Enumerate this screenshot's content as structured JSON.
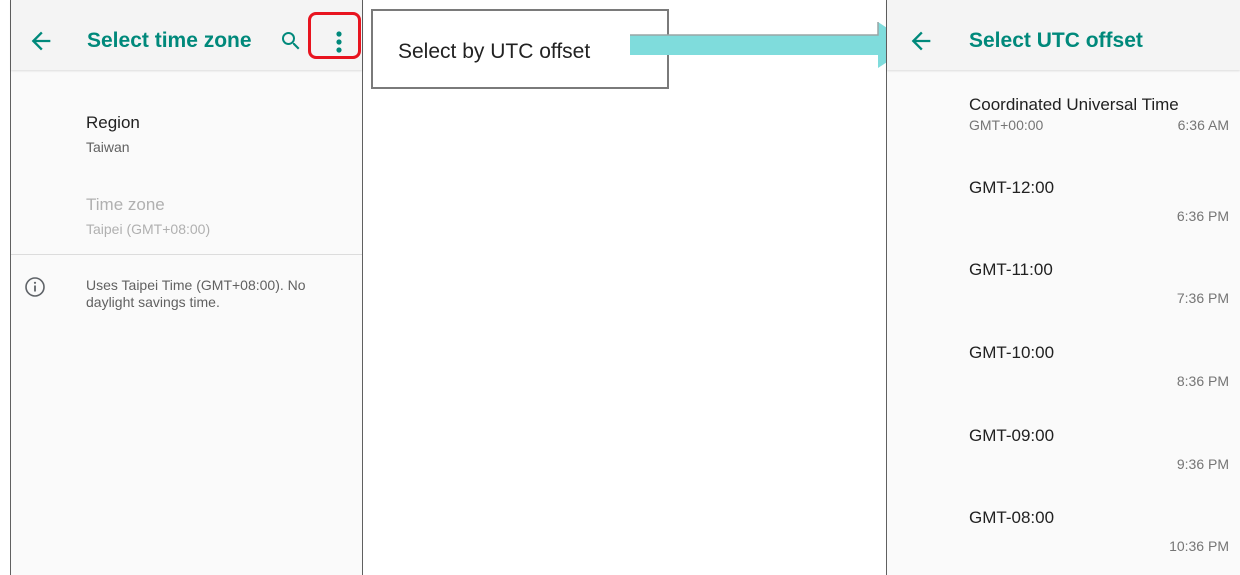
{
  "left_screen": {
    "title": "Select time zone",
    "icons": {
      "back": "arrow-left-icon",
      "search": "search-icon",
      "more": "more-vert-icon",
      "info": "info-icon"
    },
    "region": {
      "title": "Region",
      "value": "Taiwan"
    },
    "time_zone": {
      "title": "Time zone",
      "value": "Taipei (GMT+08:00)"
    },
    "footer": "Uses Taipei Time (GMT+08:00). No daylight savings time."
  },
  "callout": {
    "text": "Select by UTC offset"
  },
  "right_screen": {
    "title": "Select UTC offset",
    "items": [
      {
        "name": "Coordinated Universal Time",
        "offset": "GMT+00:00",
        "time": "6:36 AM"
      },
      {
        "name": "GMT-12:00",
        "time": "6:36 PM"
      },
      {
        "name": "GMT-11:00",
        "time": "7:36 PM"
      },
      {
        "name": "GMT-10:00",
        "time": "8:36 PM"
      },
      {
        "name": "GMT-09:00",
        "time": "9:36 PM"
      },
      {
        "name": "GMT-08:00",
        "time": "10:36 PM"
      }
    ]
  },
  "colors": {
    "accent": "#00897b",
    "highlight": "#e8141f",
    "arrow": "#7fdcdc"
  }
}
